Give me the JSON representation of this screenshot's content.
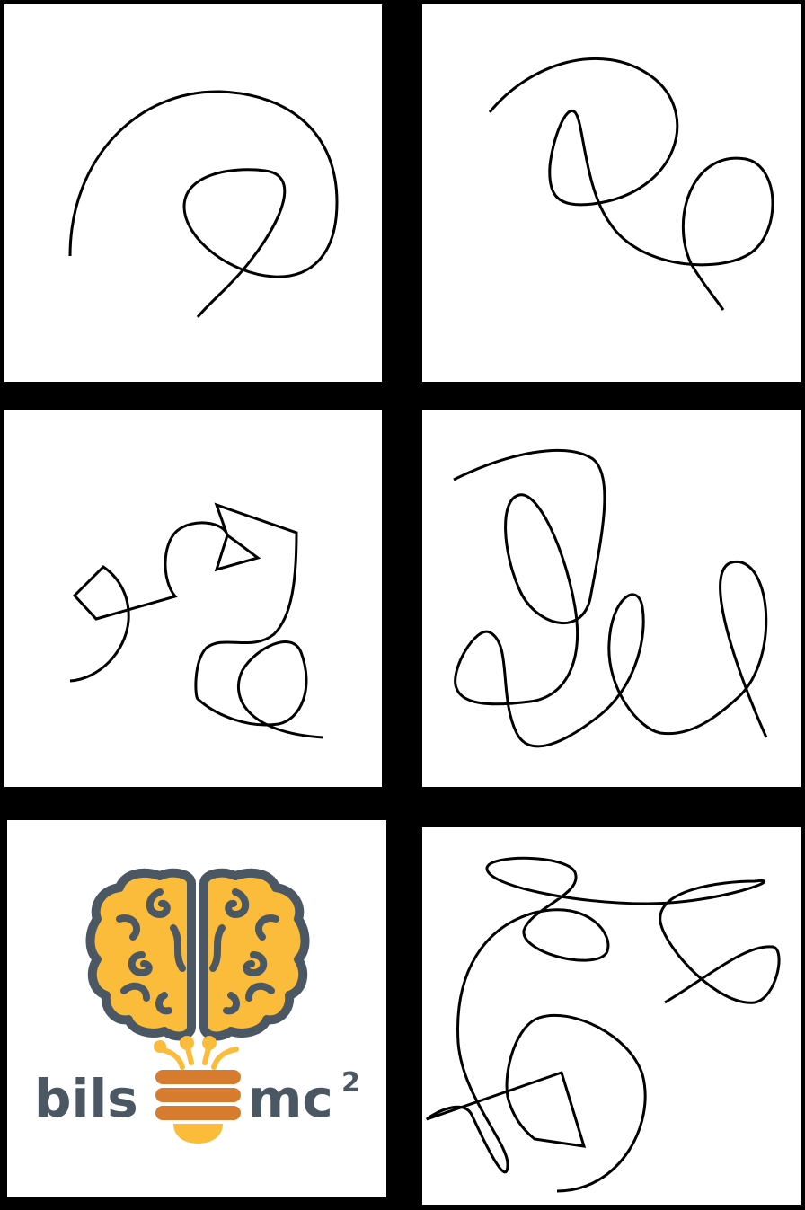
{
  "logo": {
    "left_text": "bils",
    "right_text": "mc",
    "superscript": "2",
    "colors": {
      "brain_fill": "#fbbc3c",
      "brain_outline": "#4b5863",
      "text": "#4b5863",
      "bulb_base": "#d77b2e",
      "filaments": "#fbbc3c"
    }
  },
  "tile_background": "#ffffff",
  "stroke_color": "#000000"
}
